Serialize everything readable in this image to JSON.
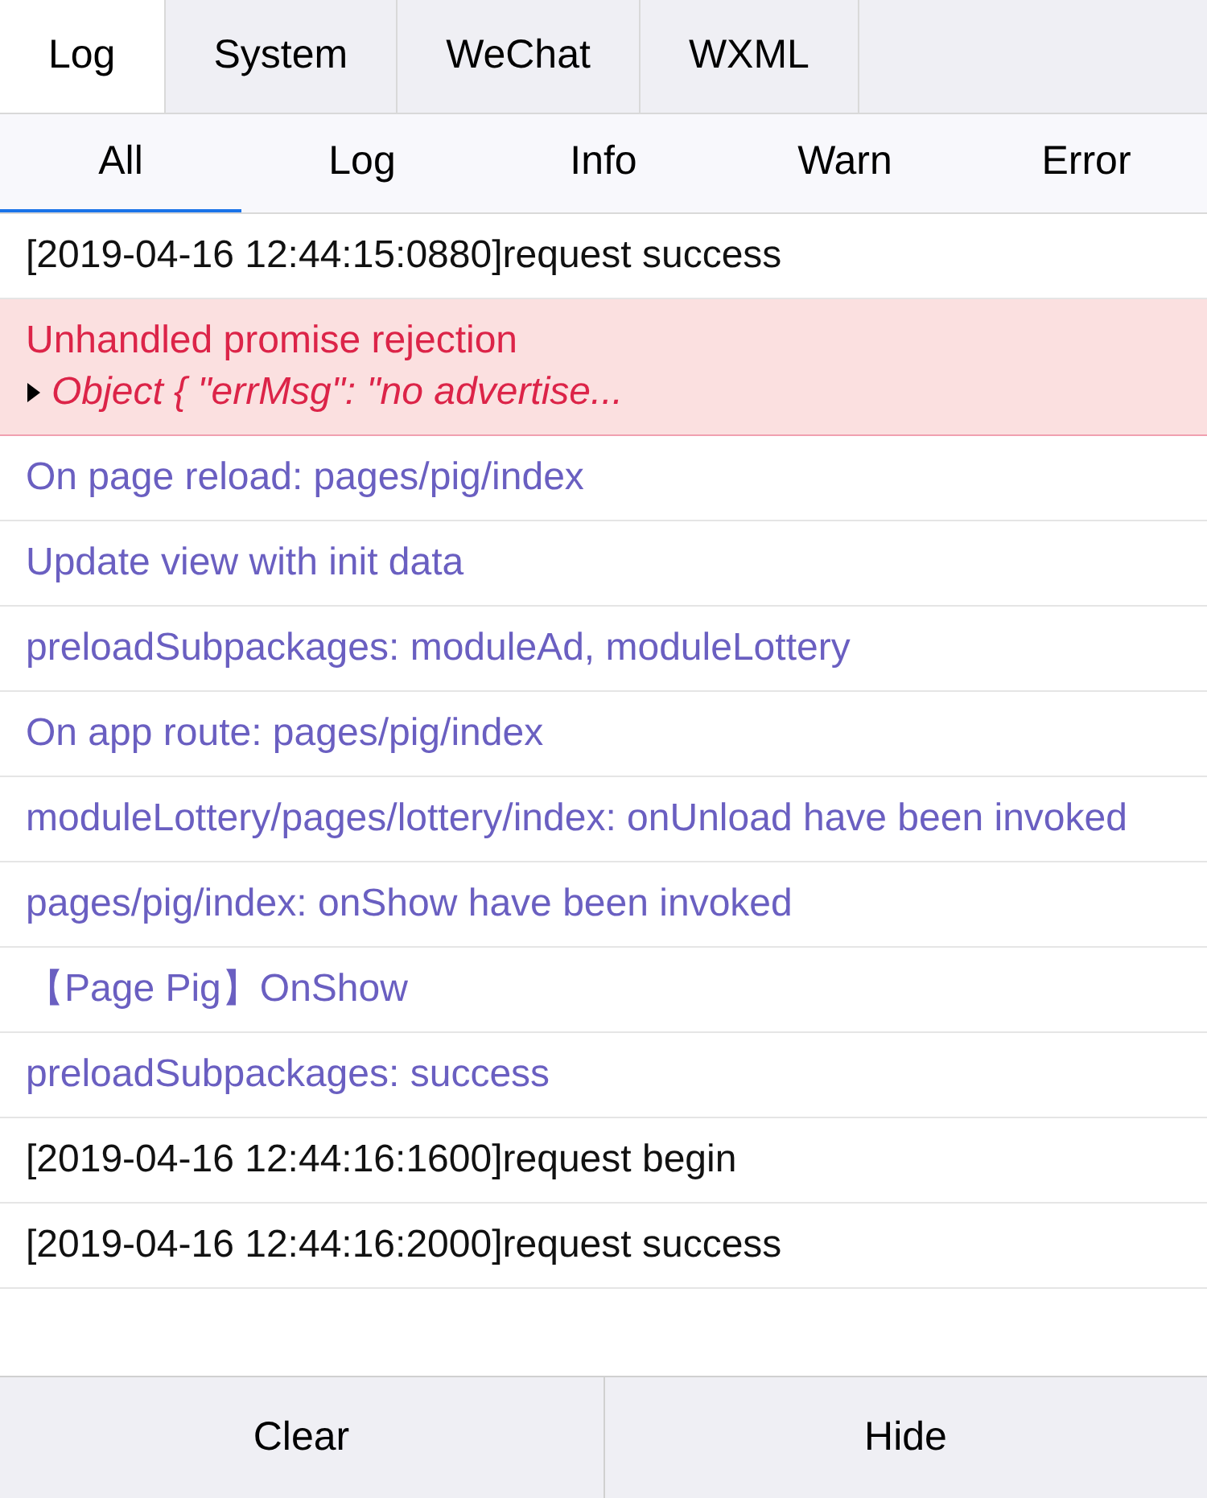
{
  "tabs": [
    {
      "label": "Log",
      "selected": true
    },
    {
      "label": "System",
      "selected": false
    },
    {
      "label": "WeChat",
      "selected": false
    },
    {
      "label": "WXML",
      "selected": false
    }
  ],
  "filters": [
    {
      "label": "All",
      "selected": true
    },
    {
      "label": "Log",
      "selected": false
    },
    {
      "label": "Info",
      "selected": false
    },
    {
      "label": "Warn",
      "selected": false
    },
    {
      "label": "Error",
      "selected": false
    }
  ],
  "logs": [
    {
      "kind": "log",
      "text": "[2019-04-16 12:44:15:0880]request success"
    },
    {
      "kind": "error",
      "text": "Unhandled promise rejection",
      "detail": "Object { \"errMsg\": \"no advertise...",
      "expanded": false
    },
    {
      "kind": "info",
      "text": "On page reload: pages/pig/index"
    },
    {
      "kind": "info",
      "text": "Update view with init data"
    },
    {
      "kind": "info",
      "text": "preloadSubpackages: moduleAd, moduleLottery"
    },
    {
      "kind": "info",
      "text": "On app route: pages/pig/index"
    },
    {
      "kind": "info",
      "text": "moduleLottery/pages/lottery/index: onUnload have been invoked"
    },
    {
      "kind": "info",
      "text": "pages/pig/index: onShow have been invoked"
    },
    {
      "kind": "info",
      "text": "【Page Pig】OnShow"
    },
    {
      "kind": "info",
      "text": "preloadSubpackages: success"
    },
    {
      "kind": "log",
      "text": "[2019-04-16 12:44:16:1600]request begin"
    },
    {
      "kind": "log",
      "text": "[2019-04-16 12:44:16:2000]request success"
    }
  ],
  "buttons": [
    "Clear",
    "Hide"
  ]
}
